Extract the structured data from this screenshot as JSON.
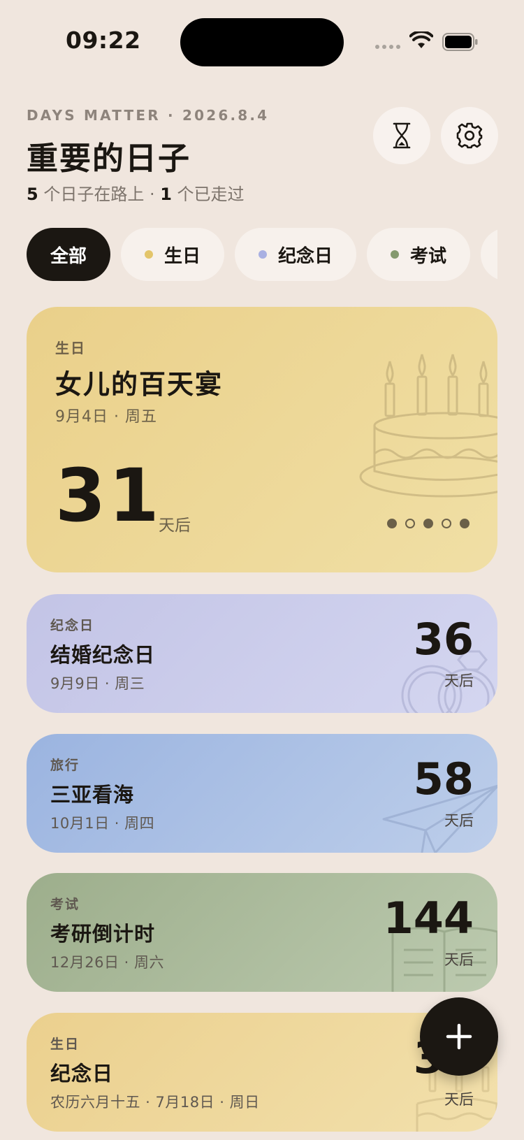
{
  "status_bar": {
    "time": "09:22"
  },
  "header": {
    "subtitle": "DAYS MATTER · 2026.8.4",
    "title": "重要的日子",
    "stats": {
      "upcoming_count": "5",
      "upcoming_text": " 个日子在路上 · ",
      "passed_count": "1",
      "passed_text": " 个已走过"
    },
    "buttons": [
      {
        "icon": "hourglass-icon"
      },
      {
        "icon": "gear-icon"
      }
    ]
  },
  "filters": [
    {
      "label": "全部",
      "active": true
    },
    {
      "label": "生日",
      "dot_color": "#E3C56A"
    },
    {
      "label": "纪念日",
      "dot_color": "#A9B0E2"
    },
    {
      "label": "考试",
      "dot_color": "#859A6E"
    },
    {
      "label": "",
      "dot_color": "#F7F1EC"
    }
  ],
  "featured": {
    "category": "生日",
    "title": "女儿的百天宴",
    "date": "9月4日 · 周五",
    "days": "31",
    "unit": "天后",
    "pager": {
      "total": 5,
      "filled": [
        0,
        2,
        4
      ]
    },
    "icon": "birthday-cake-icon"
  },
  "events": [
    {
      "category": "纪念日",
      "title": "结婚纪念日",
      "date": "9月9日 · 周三",
      "days": "36",
      "unit": "天后",
      "icon": "rings-icon",
      "color": "#C8CAEB"
    },
    {
      "category": "旅行",
      "title": "三亚看海",
      "date": "10月1日 · 周四",
      "days": "58",
      "unit": "天后",
      "icon": "paper-plane-icon",
      "color": "#AFC3E6"
    },
    {
      "category": "考试",
      "title": "考研倒计时",
      "date": "12月26日 · 周六",
      "days": "144",
      "unit": "天后",
      "icon": "book-icon",
      "color": "#AFBE9E"
    },
    {
      "category": "生日",
      "title": "纪念日",
      "date": "农历六月十五 · 7月18日 · 周日",
      "days": "34",
      "unit": "天后",
      "icon": "birthday-cake-icon",
      "color": "#EED9A0"
    }
  ],
  "fab": {
    "icon": "plus-icon"
  }
}
